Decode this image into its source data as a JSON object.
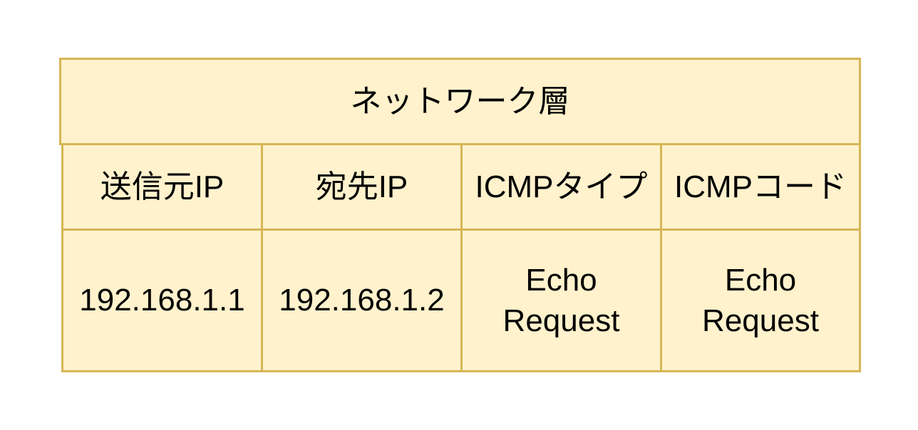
{
  "header": {
    "title": "ネットワーク層"
  },
  "fields": [
    {
      "label": "送信元IP"
    },
    {
      "label": "宛先IP"
    },
    {
      "label": "ICMPタイプ"
    },
    {
      "label": "ICMPコード"
    }
  ],
  "values": [
    {
      "text": "192.168.1.1"
    },
    {
      "text": "192.168.1.2"
    },
    {
      "text": "Echo\nRequest"
    },
    {
      "text": "Echo\nRequest"
    }
  ],
  "colors": {
    "cell_fill": "#fff2cc",
    "cell_border": "#d6b656",
    "text": "#000000",
    "background": "#ffffff"
  }
}
